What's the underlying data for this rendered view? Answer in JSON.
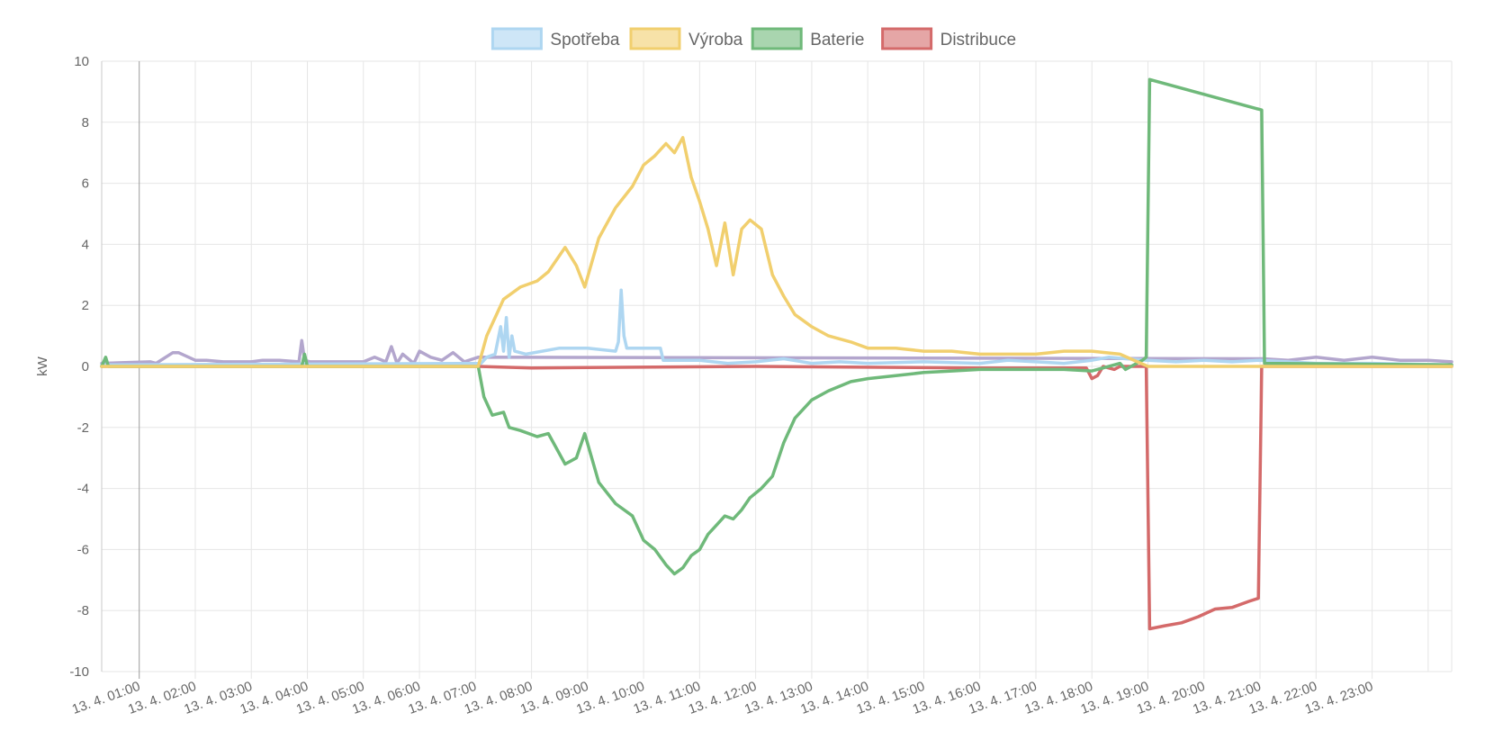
{
  "colors": {
    "spotreba": "#aed6f1",
    "vyroba": "#f1cf6e",
    "baterie": "#6fb97a",
    "distribuce": "#d46a6a",
    "unlabeled_consumption": "#b3a6cd",
    "grid": "#e6e6e6",
    "axis": "#c9c9c9",
    "text": "#666666"
  },
  "chart_data": {
    "type": "line",
    "ylabel": "kW",
    "xlabel": "",
    "ylim": [
      -10,
      10
    ],
    "yticks": [
      "10",
      "8",
      "6",
      "4",
      "2",
      "0",
      "-2",
      "-4",
      "-6",
      "-8",
      "-10"
    ],
    "xlim": [
      0.33,
      24.42
    ],
    "xticks": [
      "13. 4. 01:00",
      "13. 4. 02:00",
      "13. 4. 03:00",
      "13. 4. 04:00",
      "13. 4. 05:00",
      "13. 4. 06:00",
      "13. 4. 07:00",
      "13. 4. 08:00",
      "13. 4. 09:00",
      "13. 4. 10:00",
      "13. 4. 11:00",
      "13. 4. 12:00",
      "13. 4. 13:00",
      "13. 4. 14:00",
      "13. 4. 15:00",
      "13. 4. 16:00",
      "13. 4. 17:00",
      "13. 4. 18:00",
      "13. 4. 19:00",
      "13. 4. 20:00",
      "13. 4. 21:00",
      "13. 4. 22:00",
      "13. 4. 23:00"
    ],
    "grid": true,
    "legend_position": "top",
    "series": [
      {
        "name": "Spotřeba",
        "color_key": "spotreba",
        "x": [
          0.33,
          7.1,
          7.2,
          7.35,
          7.45,
          7.5,
          7.55,
          7.6,
          7.65,
          7.7,
          7.9,
          8.5,
          9.0,
          9.5,
          9.55,
          9.6,
          9.65,
          9.7,
          10.3,
          10.35,
          11.0,
          11.5,
          12.0,
          12.5,
          13.0,
          13.5,
          14.0,
          15.0,
          16.0,
          16.5,
          17.0,
          17.5,
          18.0,
          18.3,
          18.6,
          19.0,
          19.5,
          20.0,
          20.5,
          21.0,
          21.5,
          22.0,
          23.0,
          24.42
        ],
        "y": [
          0.05,
          0.1,
          0.3,
          0.4,
          1.3,
          0.5,
          1.6,
          0.3,
          1.0,
          0.5,
          0.4,
          0.6,
          0.6,
          0.5,
          0.8,
          2.5,
          1.0,
          0.6,
          0.6,
          0.2,
          0.2,
          0.1,
          0.15,
          0.25,
          0.1,
          0.15,
          0.1,
          0.15,
          0.1,
          0.2,
          0.15,
          0.1,
          0.2,
          0.3,
          0.25,
          0.2,
          0.15,
          0.2,
          0.15,
          0.2,
          0.15,
          0.1,
          0.1,
          0.05
        ]
      },
      {
        "name": "Výroba",
        "color_key": "vyroba",
        "x": [
          0.33,
          7.05,
          7.2,
          7.5,
          7.8,
          8.1,
          8.3,
          8.6,
          8.8,
          8.95,
          9.2,
          9.5,
          9.8,
          10.0,
          10.2,
          10.4,
          10.55,
          10.7,
          10.85,
          11.0,
          11.15,
          11.3,
          11.45,
          11.6,
          11.75,
          11.9,
          12.1,
          12.3,
          12.5,
          12.7,
          13.0,
          13.3,
          13.7,
          14.0,
          14.5,
          15.0,
          15.5,
          16.0,
          16.5,
          17.0,
          17.5,
          18.0,
          18.5,
          19.0,
          24.42
        ],
        "y": [
          0.0,
          0.0,
          1.0,
          2.2,
          2.6,
          2.8,
          3.1,
          3.9,
          3.3,
          2.6,
          4.2,
          5.2,
          5.9,
          6.6,
          6.9,
          7.3,
          7.0,
          7.5,
          6.2,
          5.4,
          4.5,
          3.3,
          4.7,
          3.0,
          4.5,
          4.8,
          4.5,
          3.0,
          2.3,
          1.7,
          1.3,
          1.0,
          0.8,
          0.6,
          0.6,
          0.5,
          0.5,
          0.4,
          0.4,
          0.4,
          0.5,
          0.5,
          0.4,
          0.0,
          0.0
        ]
      },
      {
        "name": "Baterie",
        "color_key": "baterie",
        "x": [
          0.33,
          0.4,
          0.45,
          3.9,
          3.95,
          4.0,
          7.05,
          7.15,
          7.3,
          7.5,
          7.6,
          7.8,
          8.1,
          8.3,
          8.6,
          8.8,
          8.95,
          9.2,
          9.5,
          9.8,
          10.0,
          10.2,
          10.4,
          10.55,
          10.7,
          10.85,
          11.0,
          11.15,
          11.3,
          11.45,
          11.6,
          11.75,
          11.9,
          12.1,
          12.3,
          12.5,
          12.7,
          13.0,
          13.3,
          13.7,
          14.0,
          14.5,
          15.0,
          15.5,
          16.0,
          16.5,
          17.0,
          17.5,
          18.0,
          18.2,
          18.5,
          18.6,
          18.9,
          18.97,
          19.03,
          21.03,
          21.08,
          24.42
        ],
        "y": [
          0.0,
          0.3,
          0.0,
          0.0,
          0.4,
          0.0,
          0.0,
          -1.0,
          -1.6,
          -1.5,
          -2.0,
          -2.1,
          -2.3,
          -2.2,
          -3.2,
          -3.0,
          -2.2,
          -3.8,
          -4.5,
          -4.9,
          -5.7,
          -6.0,
          -6.5,
          -6.8,
          -6.6,
          -6.2,
          -6.0,
          -5.5,
          -5.2,
          -4.9,
          -5.0,
          -4.7,
          -4.3,
          -4.0,
          -3.6,
          -2.5,
          -1.7,
          -1.1,
          -0.8,
          -0.5,
          -0.4,
          -0.3,
          -0.2,
          -0.15,
          -0.1,
          -0.1,
          -0.1,
          -0.1,
          -0.15,
          -0.05,
          0.1,
          -0.1,
          0.2,
          0.3,
          9.4,
          8.4,
          0.1,
          0.05
        ]
      },
      {
        "name": "Distribuce",
        "color_key": "distribuce",
        "x": [
          0.33,
          7.05,
          8.0,
          12.0,
          16.0,
          17.9,
          18.0,
          18.1,
          18.2,
          18.4,
          18.5,
          18.97,
          19.03,
          19.3,
          19.6,
          19.9,
          20.2,
          20.5,
          20.8,
          20.97,
          21.03,
          24.42
        ],
        "y": [
          0.0,
          0.0,
          -0.05,
          0.0,
          -0.05,
          -0.05,
          -0.4,
          -0.3,
          0.0,
          -0.1,
          0.0,
          0.0,
          -8.6,
          -8.5,
          -8.4,
          -8.2,
          -7.95,
          -7.9,
          -7.7,
          -7.6,
          0.0,
          0.0
        ]
      },
      {
        "color_key": "unlabeled_consumption",
        "x": [
          0.33,
          1.2,
          1.3,
          1.6,
          1.7,
          2.0,
          2.2,
          2.5,
          3.0,
          3.2,
          3.5,
          3.85,
          3.9,
          3.95,
          4.05,
          5.0,
          5.2,
          5.4,
          5.5,
          5.6,
          5.7,
          5.9,
          6.0,
          6.2,
          6.4,
          6.6,
          6.8,
          7.05,
          21.05,
          21.5,
          22.0,
          22.5,
          23.0,
          23.5,
          24.0,
          24.42
        ],
        "y": [
          0.1,
          0.15,
          0.1,
          0.45,
          0.45,
          0.2,
          0.2,
          0.15,
          0.15,
          0.2,
          0.2,
          0.15,
          0.85,
          0.2,
          0.15,
          0.15,
          0.3,
          0.15,
          0.65,
          0.1,
          0.4,
          0.1,
          0.5,
          0.3,
          0.2,
          0.45,
          0.15,
          0.3,
          0.25,
          0.2,
          0.3,
          0.2,
          0.3,
          0.2,
          0.2,
          0.15
        ]
      }
    ]
  }
}
